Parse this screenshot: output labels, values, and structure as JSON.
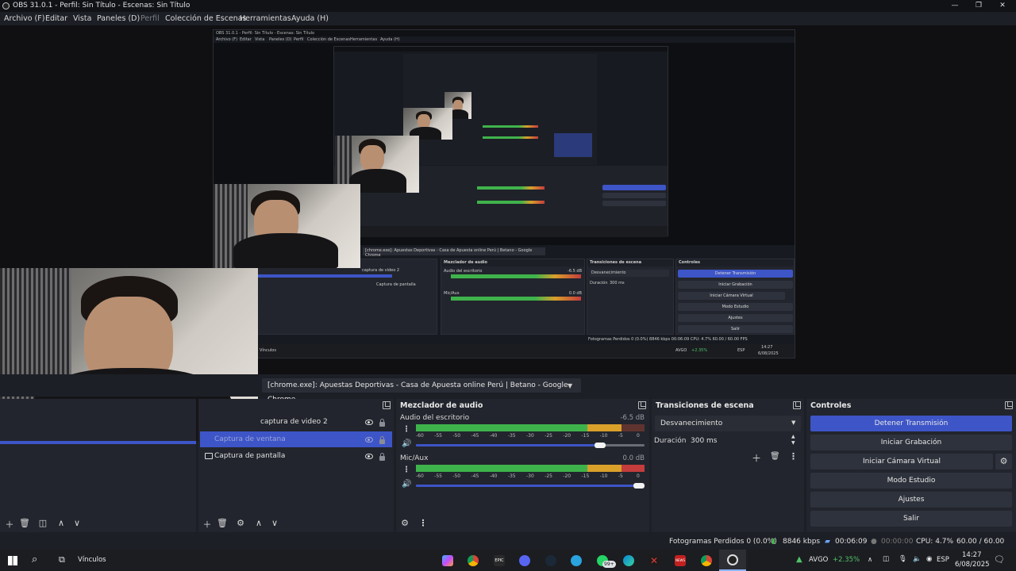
{
  "window": {
    "title": "OBS 31.0.1 - Perfil: Sin Título - Escenas: Sin Título",
    "minimize": "—",
    "maximize": "❐",
    "close": "✕"
  },
  "menu": [
    {
      "label": "Archivo (F)"
    },
    {
      "label": "Editar"
    },
    {
      "label": "Vista"
    },
    {
      "label": "Paneles (D)"
    },
    {
      "label": "Perfil"
    },
    {
      "label": "Colección de Escenas"
    },
    {
      "label": "Herramientas"
    },
    {
      "label": "Ayuda (H)"
    }
  ],
  "nested": {
    "title": "OBS 31.0.1 - Perfil: Sin Título - Escenas: Sin Título",
    "source_name": "[chrome.exe]: Apuestas Deportivas - Casa de Apuesta online Perú | Betano - Google Chrome",
    "mixer_title": "Mezclador de audio",
    "desktop_audio": "Audio del escritorio",
    "desktop_db": "-6.5 dB",
    "mic": "Mic/Aux",
    "mic_db": "0.0 dB",
    "transitions_title": "Transiciones de escena",
    "transition": "Desvanecimiento",
    "duration_label": "Duración",
    "duration": "300 ms",
    "controls_title": "Controles",
    "controls": [
      "Detener Transmisión",
      "Iniciar Grabación",
      "Iniciar Cámara Virtual",
      "Modo Estudio",
      "Ajustes",
      "Salir"
    ],
    "sources": [
      "captura de video 2",
      "Captura de pantalla"
    ],
    "status": "Fotogramas Perdidos 0 (0.0%)   8846 kbps   00:06:09   CPU: 4.7%   60.00 / 60.00 FPS",
    "taskbar_label": "Vínculos",
    "stock": "AVGO",
    "stock_change": "+2.35%",
    "lang": "ESP",
    "time": "14:27",
    "date": "6/08/2025"
  },
  "source_toolbar": {
    "source_name": "[chrome.exe]: Apuestas Deportivas - Casa de Apuesta online Perú | Betano - Google Chrome"
  },
  "sources": {
    "items": [
      {
        "label": "captura de video 2",
        "selected": false
      },
      {
        "label": "Captura de ventana",
        "selected": true
      },
      {
        "label": "Captura de pantalla",
        "selected": false
      }
    ]
  },
  "mixer": {
    "title": "Mezclador de audio",
    "channels": [
      {
        "name": "Audio del escritorio",
        "db": "-6.5 dB",
        "level": 0.87,
        "volume": 0.83
      },
      {
        "name": "Mic/Aux",
        "db": "0.0 dB",
        "level": 0.92,
        "volume": 1.0
      }
    ],
    "ticks": [
      "-60",
      "-55",
      "-50",
      "-45",
      "-40",
      "-35",
      "-30",
      "-25",
      "-20",
      "-15",
      "-10",
      "-5",
      "0"
    ]
  },
  "transitions": {
    "title": "Transiciones de escena",
    "selected": "Desvanecimiento",
    "duration_label": "Duración",
    "duration": "300 ms"
  },
  "controls": {
    "title": "Controles",
    "stop_stream": "Detener Transmisión",
    "start_record": "Iniciar Grabación",
    "start_vcam": "Iniciar Cámara Virtual",
    "studio_mode": "Modo Estudio",
    "settings": "Ajustes",
    "exit": "Salir"
  },
  "status": {
    "dropped_frames": "Fotogramas Perdidos 0 (0.0%)",
    "bitrate": "8846 kbps",
    "stream_time": "00:06:09",
    "record_time": "00:00:00",
    "cpu": "CPU: 4.7%",
    "fps": "60.00 / 60.00 FPS"
  },
  "taskbar": {
    "links_label": "Vínculos",
    "whatsapp_badge": "99+",
    "stock_symbol": "AVGO",
    "stock_change": "+2.35%",
    "language": "ESP",
    "time": "14:27",
    "date": "6/08/2025",
    "chrome_tab_label": "EPIC",
    "news_label": "NEWS"
  },
  "colors": {
    "accent": "#3d55c7",
    "meter_green": "#3fb34b",
    "meter_yellow": "#d9a02a",
    "meter_red": "#c43c3c",
    "stock_up": "#4fc36a"
  }
}
